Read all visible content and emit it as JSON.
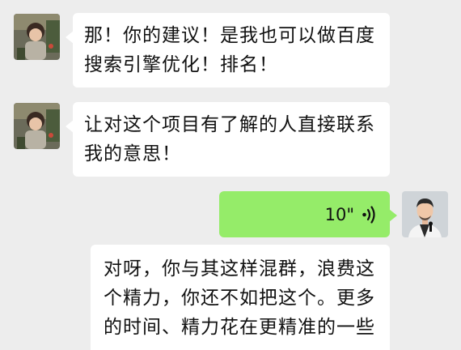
{
  "messages": [
    {
      "sender": "other",
      "lines": [
        "那！你的建议！是我也可以做百度",
        "搜索引擎优化！排名！"
      ]
    },
    {
      "sender": "other",
      "lines": [
        "让对这个项目有了解的人直接联系",
        "我的意思！"
      ]
    },
    {
      "sender": "self",
      "type": "voice",
      "duration": "10\""
    },
    {
      "sender": "other",
      "lines": [
        "对呀，你与其这样混群，浪费这",
        "个精力，你还不如把这个。更多",
        "的时间、精力花在更精准的一些"
      ]
    }
  ],
  "colors": {
    "background": "#ededed",
    "incoming_bubble": "#ffffff",
    "outgoing_bubble": "#95ec69",
    "text": "#111111"
  },
  "icons": {
    "voice": "voice-wave-icon",
    "avatar_other": "child-photo-avatar",
    "avatar_self": "man-photo-avatar"
  }
}
